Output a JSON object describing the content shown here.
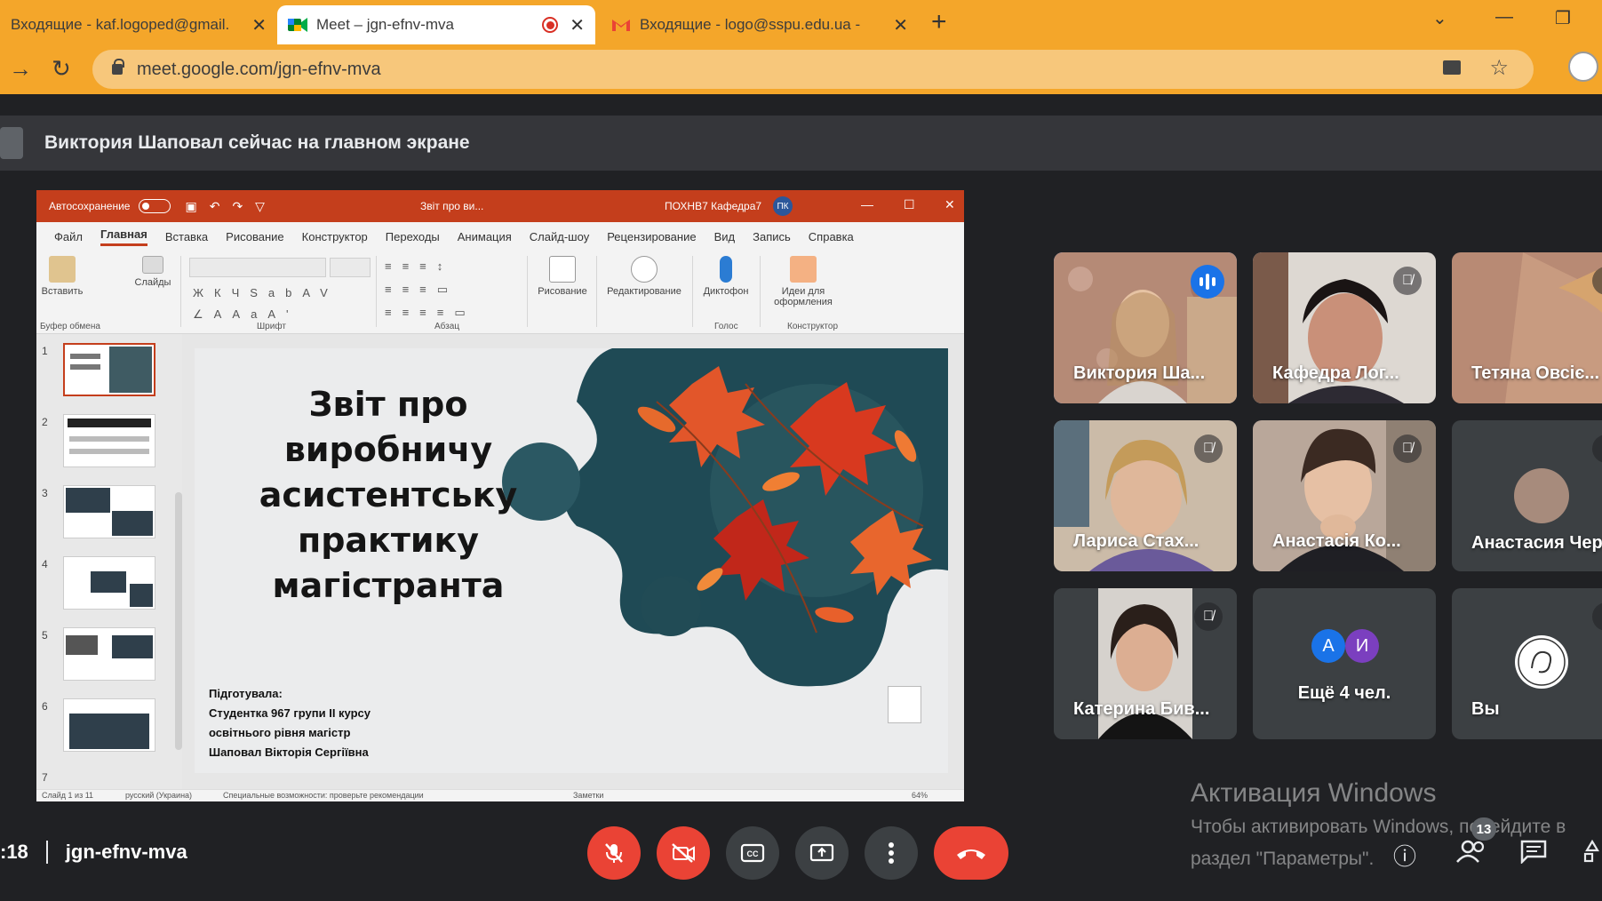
{
  "browser": {
    "tabs": [
      {
        "title": "Входящие - kaf.logoped@gmail.",
        "active": false,
        "favicon": "gmail-icon"
      },
      {
        "title": "Meet – jgn-efnv-mva",
        "active": true,
        "favicon": "meet-icon",
        "recording": true
      },
      {
        "title": "Входящие - logo@sspu.edu.ua -",
        "active": false,
        "favicon": "gmail-icon"
      }
    ],
    "url": "meet.google.com/jgn-efnv-mva",
    "accent": "#f4a62a"
  },
  "banner": {
    "text": "Виктория Шаповал сейчас на главном экране"
  },
  "ppt": {
    "autosave": "Автосохранение",
    "doc_title": "Звіт про ви...",
    "user": "ПОХНВ7 Кафедра7",
    "user_initials": "ПК",
    "tabs": [
      "Файл",
      "Главная",
      "Вставка",
      "Рисование",
      "Конструктор",
      "Переходы",
      "Анимация",
      "Слайд-шоу",
      "Рецензирование",
      "Вид",
      "Запись",
      "Справка"
    ],
    "ribbon": {
      "paste": "Вставить",
      "slides": "Слайды",
      "clipboard": "Буфер обмена",
      "font": "Шрифт",
      "paragraph": "Абзац",
      "drawing": "Рисование",
      "editing": "Редактирование",
      "dictate": "Диктофон",
      "voice": "Голос",
      "ideas": "Идеи для оформления",
      "designer": "Конструктор"
    },
    "slide_numbers": [
      "1",
      "2",
      "3",
      "4",
      "5",
      "6",
      "7"
    ],
    "slide": {
      "title_lines": [
        "Звіт про виробничу",
        "асистентську",
        "практику",
        "магістранта"
      ],
      "prepared_label": "Підготувала:",
      "prepared_lines": [
        "Студентка 967 групи ІІ курсу",
        "освітнього рівня магістр",
        "Шаповал Вікторія Сергіївна"
      ]
    },
    "status": {
      "slide_of": "Слайд 1 из 11",
      "lang": "русский (Украина)",
      "accessibility": "Специальные возможности: проверьте рекомендации",
      "notes": "Заметки",
      "zoom": "64%"
    },
    "accent": "#c43e1c"
  },
  "participants": [
    {
      "name": "Виктория Ша...",
      "speaking": true,
      "muted": false
    },
    {
      "name": "Кафедра Лог...",
      "speaking": false,
      "muted": true
    },
    {
      "name": "Тетяна Овсіє...",
      "speaking": false,
      "muted": true
    },
    {
      "name": "Лариса Стах...",
      "speaking": false,
      "muted": true
    },
    {
      "name": "Анастасія Ко...",
      "speaking": false,
      "muted": true
    },
    {
      "name": "Анастасия Чер",
      "speaking": false,
      "muted": true
    },
    {
      "name": "Катерина Бив...",
      "speaking": false,
      "muted": true
    },
    {
      "name": "Ещё 4 чел.",
      "initials": [
        "А",
        "И"
      ]
    },
    {
      "name": "Вы",
      "muted": true
    }
  ],
  "bottom": {
    "time": ":18",
    "meeting_code": "jgn-efnv-mva",
    "people_count": "13"
  },
  "activation": {
    "title": "Активация Windows",
    "line1": "Чтобы активировать Windows, перейдите в",
    "line2": "раздел \"Параметры\"."
  }
}
